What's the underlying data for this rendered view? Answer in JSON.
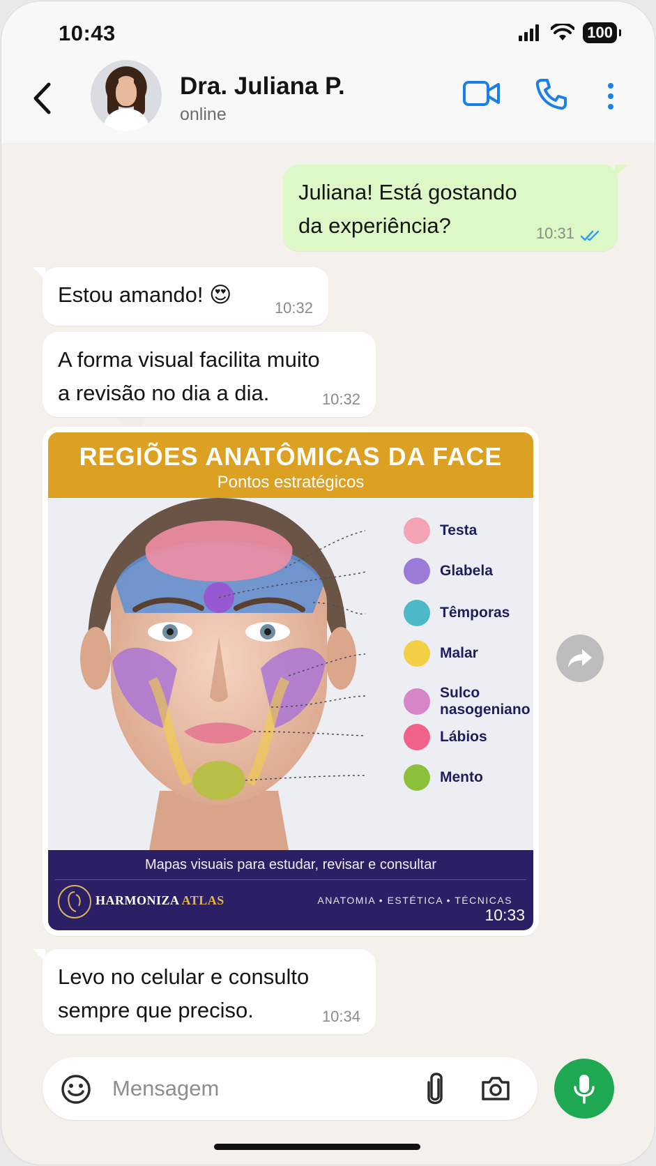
{
  "status_bar": {
    "time": "10:43",
    "battery": "100"
  },
  "header": {
    "contact_name": "Dra. Juliana P.",
    "contact_status": "online"
  },
  "messages": [
    {
      "direction": "out",
      "lines": [
        "Juliana! Está gostando",
        "da experiência?"
      ],
      "time": "10:31",
      "read": true
    },
    {
      "direction": "in",
      "lines": [
        "Estou amando! 😍"
      ],
      "time": "10:32"
    },
    {
      "direction": "in",
      "lines": [
        "A forma visual facilita muito",
        "a revisão no dia a dia."
      ],
      "time": "10:32"
    },
    {
      "direction": "in",
      "lines": [
        "Levo no celular e consulto",
        "sempre que preciso."
      ],
      "time": "10:34"
    }
  ],
  "image_message": {
    "time": "10:33",
    "title": "REGIÕES ANATÔMICAS DA FACE",
    "subtitle": "Pontos estratégicos",
    "legend": [
      {
        "label": "Testa",
        "color": "#f4a3b5"
      },
      {
        "label": "Glabela",
        "color": "#9b7ad8"
      },
      {
        "label": "Têmporas",
        "color": "#4db8c8"
      },
      {
        "label": "Malar",
        "color": "#f2cf44"
      },
      {
        "label": "Sulco nasogeniano",
        "color": "#d884c9"
      },
      {
        "label": "Lábios",
        "color": "#f0628a"
      },
      {
        "label": "Mento",
        "color": "#8cbf3a"
      }
    ],
    "footer_tagline": "Mapas visuais para estudar, revisar e consultar",
    "brand_main": "HARMONIZA",
    "brand_accent": "ATLAS",
    "footer_tags": "ANATOMIA • ESTÉTICA • TÉCNICAS"
  },
  "composer": {
    "placeholder": "Mensagem"
  },
  "colors": {
    "accent_blue": "#1a7fe8",
    "outgoing_bubble": "#dcf8c6",
    "mic_green": "#1da851",
    "header_gold": "#dca022",
    "footer_navy": "#2b1f66"
  }
}
